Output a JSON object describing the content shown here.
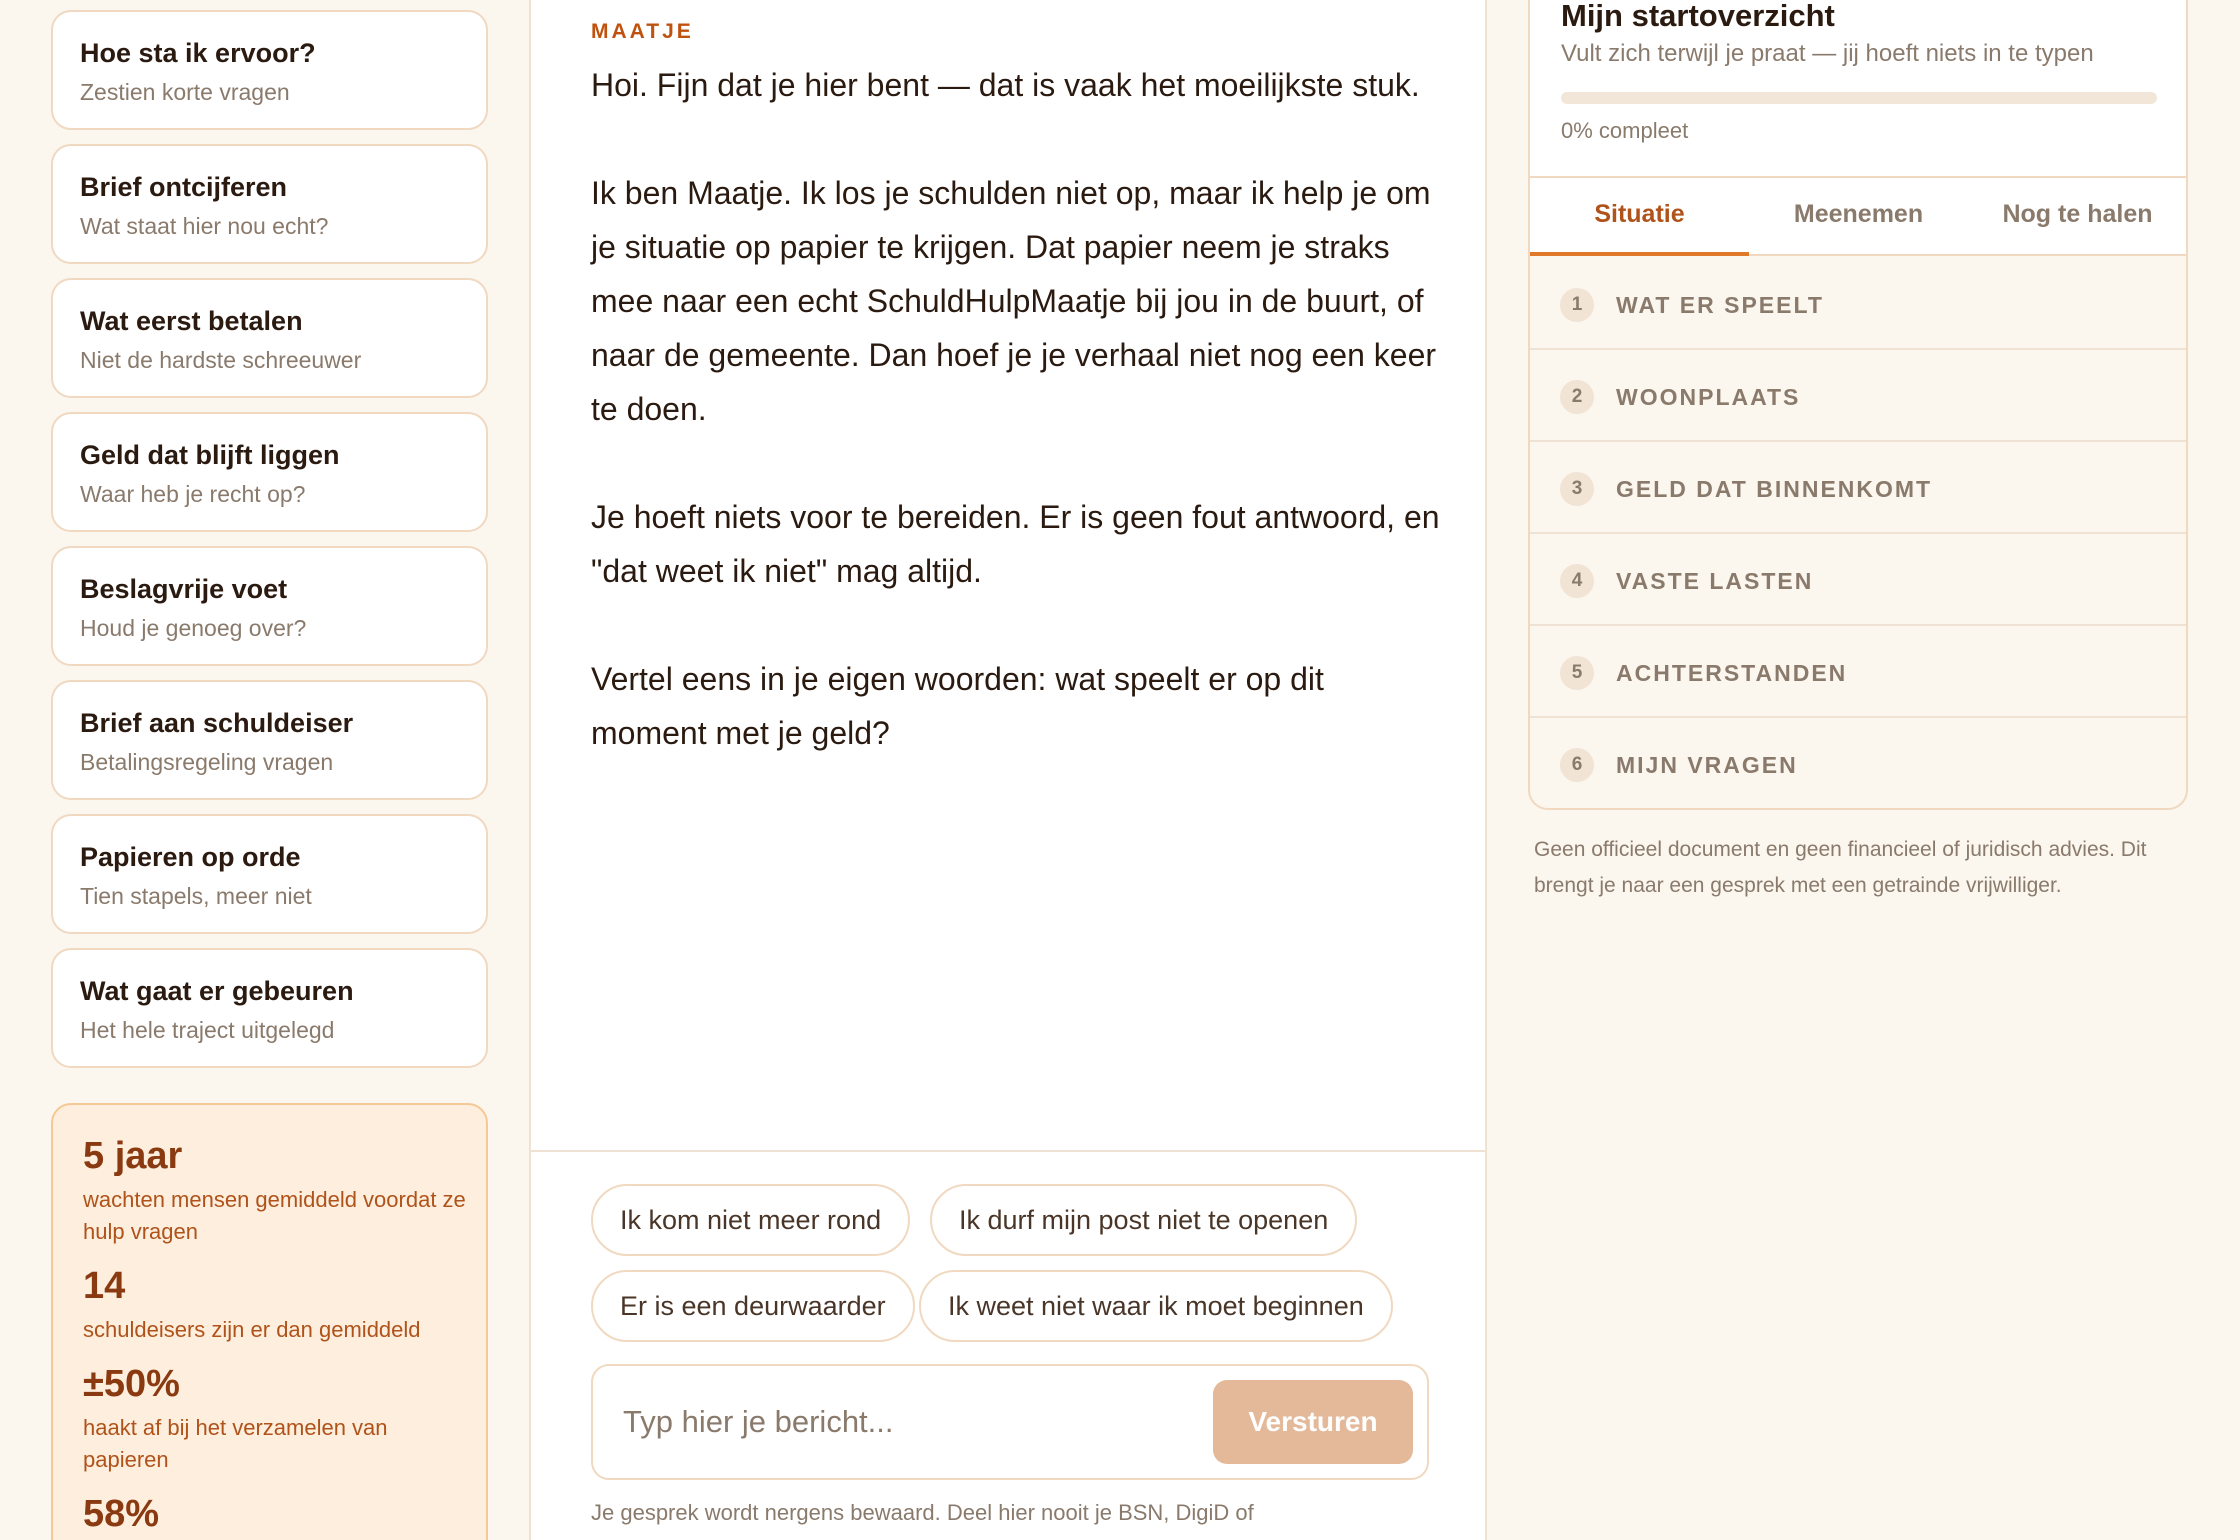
{
  "sidebar": {
    "items": [
      {
        "title": "Hoe sta ik ervoor?",
        "sub": "Zestien korte vragen"
      },
      {
        "title": "Brief ontcijferen",
        "sub": "Wat staat hier nou echt?"
      },
      {
        "title": "Wat eerst betalen",
        "sub": "Niet de hardste schreeuwer"
      },
      {
        "title": "Geld dat blijft liggen",
        "sub": "Waar heb je recht op?"
      },
      {
        "title": "Beslagvrije voet",
        "sub": "Houd je genoeg over?"
      },
      {
        "title": "Brief aan schuldeiser",
        "sub": "Betalingsregeling vragen"
      },
      {
        "title": "Papieren op orde",
        "sub": "Tien stapels, meer niet"
      },
      {
        "title": "Wat gaat er gebeuren",
        "sub": "Het hele traject uitgelegd"
      }
    ],
    "stats": [
      {
        "value": "5 jaar",
        "label": "wachten mensen gemiddeld voordat ze hulp vragen"
      },
      {
        "value": "14",
        "label": "schuldeisers zijn er dan gemiddeld"
      },
      {
        "value": "±50%",
        "label": "haakt af bij het verzamelen van papieren"
      },
      {
        "value": "58%",
        "label": ""
      }
    ]
  },
  "chat": {
    "sender": "MAATJE",
    "paragraphs": [
      "Hoi. Fijn dat je hier bent — dat is vaak het moeilijkste stuk.",
      "Ik ben Maatje. Ik los je schulden niet op, maar ik help je om je situatie op papier te krijgen. Dat papier neem je straks mee naar een echt SchuldHulpMaatje bij jou in de buurt, of naar de gemeente. Dan hoef je je verhaal niet nog een keer te doen.",
      "Je hoeft niets voor te bereiden. Er is geen fout antwoord, en \"dat weet ik niet\" mag altijd.",
      "Vertel eens in je eigen woorden: wat speelt er op dit moment met je geld?"
    ],
    "suggestions": [
      "Ik kom niet meer rond",
      "Ik durf mijn post niet te openen",
      "Er is een deurwaarder",
      "Ik weet niet waar ik moet beginnen"
    ],
    "input_placeholder": "Typ hier je bericht...",
    "send_label": "Versturen",
    "privacy_note": "Je gesprek wordt nergens bewaard. Deel hier nooit je BSN, DigiD of"
  },
  "overview": {
    "title": "Mijn startoverzicht",
    "subtitle": "Vult zich terwijl je praat — jij hoeft niets in te typen",
    "progress": 0,
    "progress_label": "0% compleet",
    "tabs": [
      "Situatie",
      "Meenemen",
      "Nog te halen"
    ],
    "active_tab": 0,
    "sections": [
      {
        "num": "1",
        "label": "WAT ER SPEELT"
      },
      {
        "num": "2",
        "label": "WOONPLAATS"
      },
      {
        "num": "3",
        "label": "GELD DAT BINNENKOMT"
      },
      {
        "num": "4",
        "label": "VASTE LASTEN"
      },
      {
        "num": "5",
        "label": "ACHTERSTANDEN"
      },
      {
        "num": "6",
        "label": "MIJN VRAGEN"
      }
    ],
    "disclaimer": "Geen officieel document en geen financieel of juridisch advies. Dit brengt je naar een gesprek met een getrainde vrijwilliger."
  },
  "colors": {
    "accent": "#e07a2a",
    "accent_dark": "#b0531b",
    "background": "#fbf6ee",
    "send_button": "#e4b99a"
  }
}
